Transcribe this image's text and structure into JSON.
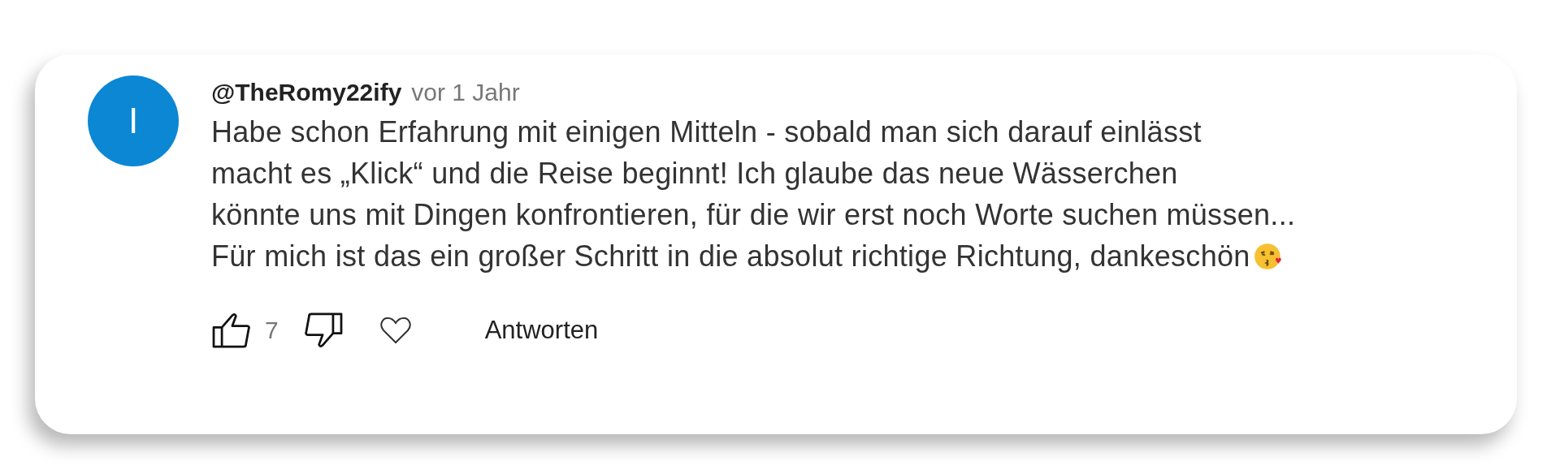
{
  "comment": {
    "avatar_letter": "I",
    "color": "#0b87d4",
    "author": "@TheRomy22ify",
    "time": "vor 1 Jahr",
    "text_lines": [
      "Habe schon Erfahrung mit einigen Mitteln - sobald man sich darauf einlässt",
      "macht es „Klick“ und die Reise beginnt! Ich glaube das neue Wässerchen",
      "könnte uns mit Dingen konfrontieren, für die wir erst noch Worte suchen müssen...",
      "Für mich ist das ein großer Schritt in die absolut richtige Richtung, dankeschön"
    ],
    "ends_with_emoji": true,
    "likes": "7",
    "reply": "Antworten"
  }
}
